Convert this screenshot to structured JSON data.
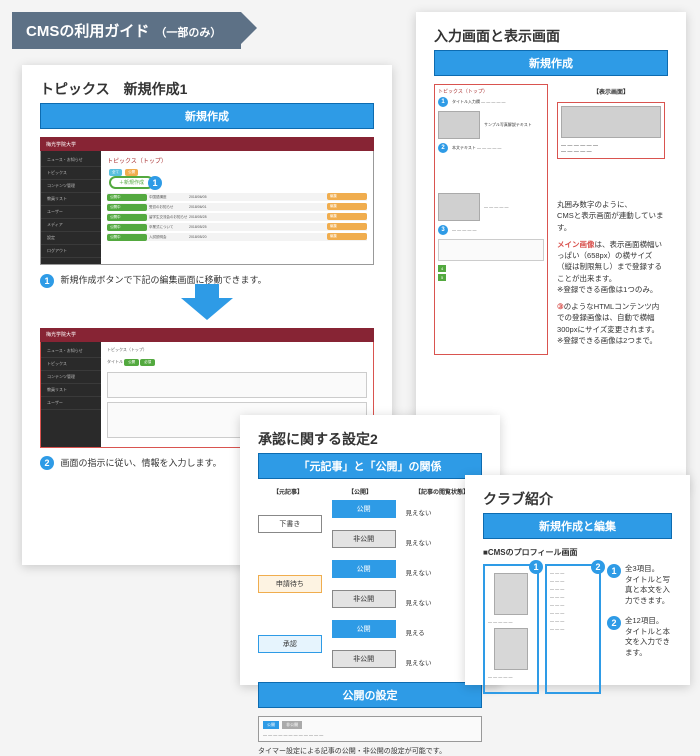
{
  "ribbon": {
    "title": "CMSの利用ガイド",
    "subtitle": "（一部のみ）"
  },
  "page1": {
    "title": "トピックス　新規作成1",
    "bluebar": "新規作成",
    "window_brand": "梅光学院大学",
    "window_title": "トピックス（トップ）",
    "sidebar_items": [
      "ニュース・お知らせ",
      "トピックス",
      "コンテンツ管理",
      "教員リスト",
      "ユーザー",
      "メディア",
      "設定",
      "ログアウト"
    ],
    "new_button": "＋新規作成",
    "table_rows": [
      {
        "status": "公開中",
        "title": "中国語講座",
        "date": "2018/06/05",
        "tags": [
          "編集",
          "複製"
        ]
      },
      {
        "status": "公開中",
        "title": "受賞のお知らせ",
        "date": "2018/06/01",
        "tags": [
          "編集",
          "複製"
        ]
      },
      {
        "status": "公開中",
        "title": "留学生交流会のお知らせ",
        "date": "2018/05/28",
        "tags": [
          "編集",
          "複製"
        ]
      },
      {
        "status": "公開中",
        "title": "卒業式について",
        "date": "2018/05/25",
        "tags": [
          "編集",
          "複製"
        ]
      },
      {
        "status": "公開中",
        "title": "入試説明会",
        "date": "2018/05/20",
        "tags": [
          "編集",
          "複製"
        ]
      }
    ],
    "caption1": "新規作成ボタンで下記の編集画面に移動できます。",
    "caption2": "画面の指示に従い、情報を入力します。",
    "editor_label_title": "タイトル"
  },
  "page2": {
    "title": "入力画面と表示画面",
    "bluebar": "新規作成",
    "disp_header": "【表示画面】",
    "input_header": "トピックス（トップ）",
    "notes": [
      "丸囲み数字のように、",
      "CMSと表示画面が連動しています。"
    ],
    "main_image_label": "メイン画像",
    "main_image_note": "は、表示画面横幅いっぱい（658px）の横サイズ（縦は制限無し）まで登録することが出来ます。\n※登録できる画像は1つのみ。",
    "content_note_label": "③",
    "content_note": "のようなHTMLコンテンツ内での登録画像は、自動で横幅300pxにサイズ変更されます。\n※登録できる画像は2つまで。"
  },
  "page3": {
    "title": "承認に関する設定2",
    "bluebar1": "「元記事」と「公開」の関係",
    "col_headers": [
      "【元記事】",
      "【公開】",
      "【記事の閲覧状態】"
    ],
    "left_states": [
      "下書き",
      "申請待ち",
      "承認"
    ],
    "pub_pairs": [
      [
        "公開",
        "見えない"
      ],
      [
        "非公開",
        "見えない"
      ],
      [
        "公開",
        "見えない"
      ],
      [
        "非公開",
        "見えない"
      ],
      [
        "公開",
        "見える"
      ],
      [
        "非公開",
        "見えない"
      ]
    ],
    "bluebar2": "公開の設定",
    "timer_note": "タイマー設定による記事の公開・非公開の設定が可能です。"
  },
  "page4": {
    "title": "クラブ紹介",
    "bluebar": "新規作成と編集",
    "subtitle": "■CMSのプロフィール画面",
    "notes": [
      {
        "n": "1",
        "text": "全3項目。\nタイトルと写真と本文を入力できます。"
      },
      {
        "n": "2",
        "text": "全12項目。\nタイトルと本文を入力できます。"
      }
    ]
  }
}
